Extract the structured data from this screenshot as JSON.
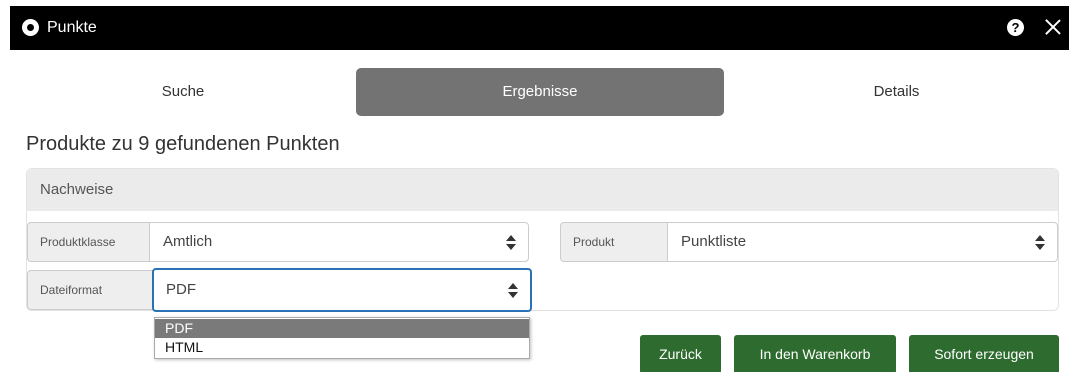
{
  "window": {
    "title": "Punkte",
    "help_symbol": "?"
  },
  "tabs": [
    {
      "label": "Suche",
      "active": false
    },
    {
      "label": "Ergebnisse",
      "active": true
    },
    {
      "label": "Details",
      "active": false
    }
  ],
  "heading": "Produkte zu 9 gefundenen Punkten",
  "panel": {
    "title": "Nachweise",
    "fields": {
      "produktklasse": {
        "label": "Produktklasse",
        "value": "Amtlich"
      },
      "produkt": {
        "label": "Produkt",
        "value": "Punktliste"
      },
      "dateiformat": {
        "label": "Dateiformat",
        "value": "PDF",
        "options": [
          "PDF",
          "HTML"
        ],
        "open": true
      }
    }
  },
  "buttons": {
    "back": "Zurück",
    "cart": "In den Warenkorb",
    "generate": "Sofort erzeugen"
  },
  "colors": {
    "titlebar": "#000000",
    "active_tab": "#737373",
    "button": "#2e6b2e",
    "focus_border": "#2a72b5",
    "selected_option": "#7a7a7a"
  }
}
